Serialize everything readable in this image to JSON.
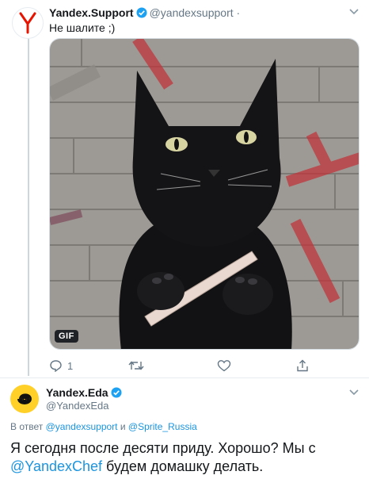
{
  "tweet1": {
    "name": "Yandex.Support",
    "handle": "@yandexsupport",
    "separator": "·",
    "text": "Не шалите ;)",
    "media_badge": "GIF",
    "reply_count": "1"
  },
  "tweet2": {
    "name": "Yandex.Eda",
    "handle": "@YandexEda",
    "reply_prefix": "В ответ",
    "reply_user1": "@yandexsupport",
    "reply_and": "и",
    "reply_user2": "@Sprite_Russia",
    "text_part1": "Я сегодня после десяти приду. Хорошо? Мы с",
    "mention": "@YandexChef",
    "text_part2": "будем домашку делать."
  },
  "colors": {
    "link": "#1b95e0",
    "secondary_text": "#657786",
    "verified": "#1da1f2",
    "yandex_red": "#e61400",
    "eda_yellow": "#ffd027"
  }
}
